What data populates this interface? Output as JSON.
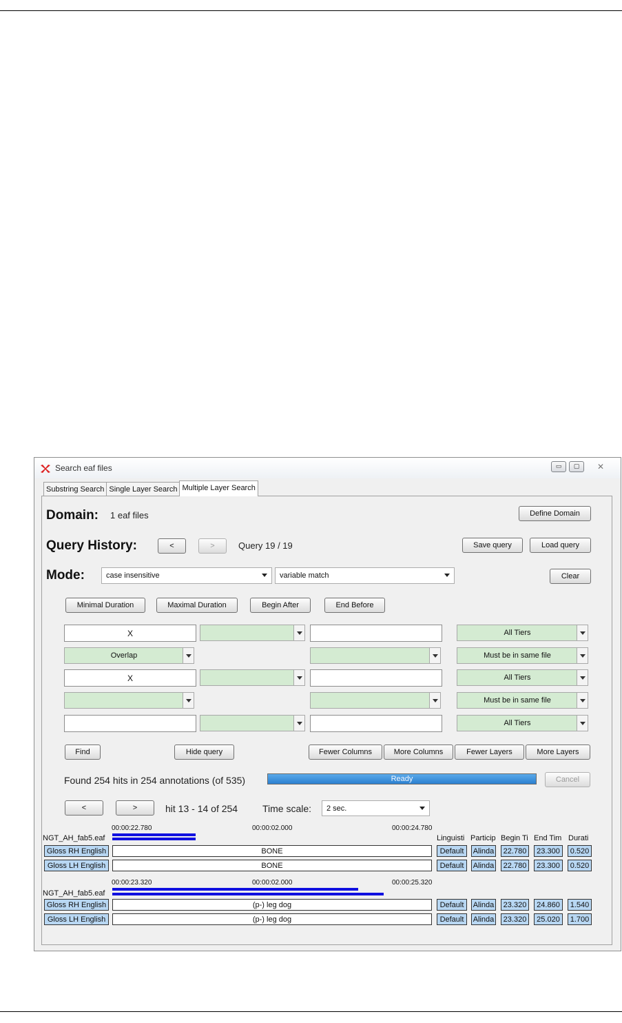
{
  "window": {
    "title": "Search eaf files",
    "buttons": {
      "minimize": "▭",
      "maximize": "▢",
      "close": "✕"
    }
  },
  "tabs": [
    {
      "label": "Substring Search"
    },
    {
      "label": "Single Layer Search"
    },
    {
      "label": "Multiple Layer Search",
      "active": true
    }
  ],
  "domain": {
    "label": "Domain:",
    "value": "1 eaf files",
    "define_button": "Define Domain"
  },
  "history": {
    "label": "Query History:",
    "prev": "<",
    "next": ">",
    "status": "Query 19 / 19",
    "save": "Save query",
    "load": "Load query"
  },
  "mode": {
    "label": "Mode:",
    "case": "case insensitive",
    "match": "variable match",
    "clear": "Clear"
  },
  "constraints": {
    "min": "Minimal Duration",
    "max": "Maximal Duration",
    "begin": "Begin After",
    "end": "End Before"
  },
  "query": {
    "row1": {
      "text": "X",
      "tiers": "All Tiers"
    },
    "row2": {
      "relation": "Overlap",
      "scope": "Must be in same file"
    },
    "row3": {
      "text": "X",
      "tiers": "All Tiers"
    },
    "row4": {
      "relation": "",
      "scope": "Must be in same file"
    },
    "row5": {
      "text": "",
      "tiers": "All Tiers"
    }
  },
  "actions": {
    "find": "Find",
    "hide": "Hide query",
    "fewer_columns": "Fewer Columns",
    "more_columns": "More Columns",
    "fewer_layers": "Fewer Layers",
    "more_layers": "More Layers"
  },
  "results": {
    "found": "Found 254 hits in 254 annotations (of 535)",
    "progress_label": "Ready",
    "progress": 1.0,
    "cancel": "Cancel"
  },
  "nav": {
    "prev": "<",
    "next": ">",
    "hit": "hit 13 - 14 of 254",
    "timescale_label": "Time scale:",
    "timescale_value": "2 sec."
  },
  "columns": {
    "linguistic": "Linguisti",
    "participant": "Particip",
    "begin": "Begin Ti",
    "end": "End Tim",
    "duration": "Durati"
  },
  "hits": [
    {
      "file": "NGT_AH_fab5.eaf",
      "t_start": "00:00:22.780",
      "t_mid": "00:00:02.000",
      "t_end": "00:00:24.780",
      "rows": [
        {
          "tier": "Gloss RH English",
          "annotation": "BONE",
          "linguistic": "Default",
          "participant": "Alinda",
          "begin": "22.780",
          "end": "23.300",
          "duration": "0.520"
        },
        {
          "tier": "Gloss LH English",
          "annotation": "BONE",
          "linguistic": "Default",
          "participant": "Alinda",
          "begin": "22.780",
          "end": "23.300",
          "duration": "0.520"
        }
      ]
    },
    {
      "file": "NGT_AH_fab5.eaf",
      "t_start": "00:00:23.320",
      "t_mid": "00:00:02.000",
      "t_end": "00:00:25.320",
      "rows": [
        {
          "tier": "Gloss RH English",
          "annotation": "(p-) leg dog",
          "linguistic": "Default",
          "participant": "Alinda",
          "begin": "23.320",
          "end": "24.860",
          "duration": "1.540"
        },
        {
          "tier": "Gloss LH English",
          "annotation": "(p-) leg dog",
          "linguistic": "Default",
          "participant": "Alinda",
          "begin": "23.320",
          "end": "25.020",
          "duration": "1.700"
        }
      ]
    }
  ]
}
